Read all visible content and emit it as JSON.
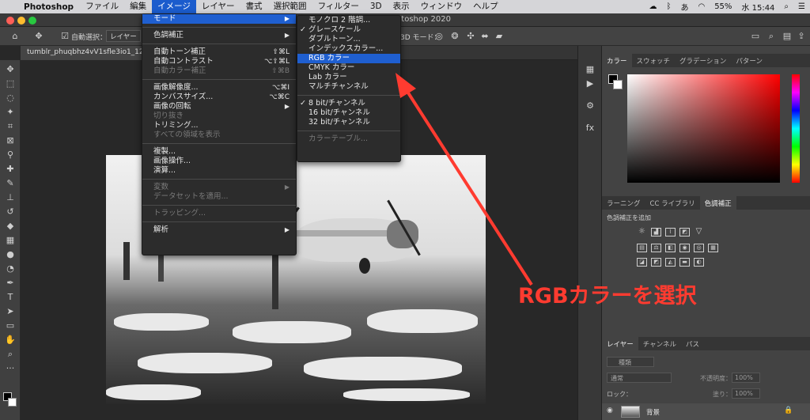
{
  "menubar": {
    "app": "Photoshop",
    "items": [
      "ファイル",
      "編集",
      "イメージ",
      "レイヤー",
      "書式",
      "選択範囲",
      "フィルター",
      "3D",
      "表示",
      "ウィンドウ",
      "ヘルプ"
    ],
    "active": "イメージ",
    "battery": "55%",
    "ime": "あ",
    "clock": "水 15:44"
  },
  "window": {
    "title": "Adobe Photoshop 2020"
  },
  "options": {
    "auto_select": "自動選択：",
    "layer_select": "レイヤー",
    "mode3d": "3D モード："
  },
  "document": {
    "tab": "tumblr_phuqbhz4vV1sfle3io1_1280.jpg @ 100%"
  },
  "image_menu": {
    "items": [
      {
        "label": "モード",
        "arrow": "▶",
        "selected": true
      },
      {
        "sep": true
      },
      {
        "label": "色調補正",
        "arrow": "▶"
      },
      {
        "sep": true
      },
      {
        "label": "自動トーン補正",
        "shortcut": "⇧⌘L"
      },
      {
        "label": "自動コントラスト",
        "shortcut": "⌥⇧⌘L"
      },
      {
        "label": "自動カラー補正",
        "shortcut": "⇧⌘B",
        "disabled": true
      },
      {
        "sep": true
      },
      {
        "label": "画像解像度...",
        "shortcut": "⌥⌘I"
      },
      {
        "label": "カンバスサイズ...",
        "shortcut": "⌥⌘C"
      },
      {
        "label": "画像の回転",
        "arrow": "▶"
      },
      {
        "label": "切り抜き",
        "disabled": true
      },
      {
        "label": "トリミング..."
      },
      {
        "label": "すべての領域を表示",
        "disabled": true
      },
      {
        "sep": true
      },
      {
        "label": "複製..."
      },
      {
        "label": "画像操作..."
      },
      {
        "label": "演算..."
      },
      {
        "sep": true
      },
      {
        "label": "変数",
        "arrow": "▶",
        "disabled": true
      },
      {
        "label": "データセットを適用...",
        "disabled": true
      },
      {
        "sep": true
      },
      {
        "label": "トラッピング...",
        "disabled": true
      },
      {
        "sep": true
      },
      {
        "label": "解析",
        "arrow": "▶"
      }
    ]
  },
  "mode_menu": {
    "items": [
      {
        "label": "モノクロ 2 階調..."
      },
      {
        "label": "グレースケール",
        "checked": true
      },
      {
        "label": "ダブルトーン..."
      },
      {
        "label": "インデックスカラー..."
      },
      {
        "label": "RGB カラー",
        "selected": true
      },
      {
        "label": "CMYK カラー"
      },
      {
        "label": "Lab カラー"
      },
      {
        "label": "マルチチャンネル"
      },
      {
        "sep": true
      },
      {
        "label": "8 bit/チャンネル",
        "checked": true
      },
      {
        "label": "16 bit/チャンネル"
      },
      {
        "label": "32 bit/チャンネル"
      },
      {
        "sep": true
      },
      {
        "label": "カラーテーブル...",
        "disabled": true
      }
    ]
  },
  "panels": {
    "color_tabs": [
      "カラー",
      "スウォッチ",
      "グラデーション",
      "パターン"
    ],
    "adjust_tabs": [
      "ラーニング",
      "CC ライブラリ",
      "色調補正"
    ],
    "adjust_hint": "色調補正を追加",
    "layer_tabs": [
      "レイヤー",
      "チャンネル",
      "パス"
    ],
    "search_kind": "種類",
    "blend_mode": "通常",
    "opacity_label": "不透明度：",
    "opacity": "100%",
    "lock_label": "ロック：",
    "fill_label": "塗り：",
    "fill": "100%",
    "layer_name": "背景"
  },
  "annotation": {
    "text": "RGBカラーを選択",
    "color": "#ff3b30"
  }
}
